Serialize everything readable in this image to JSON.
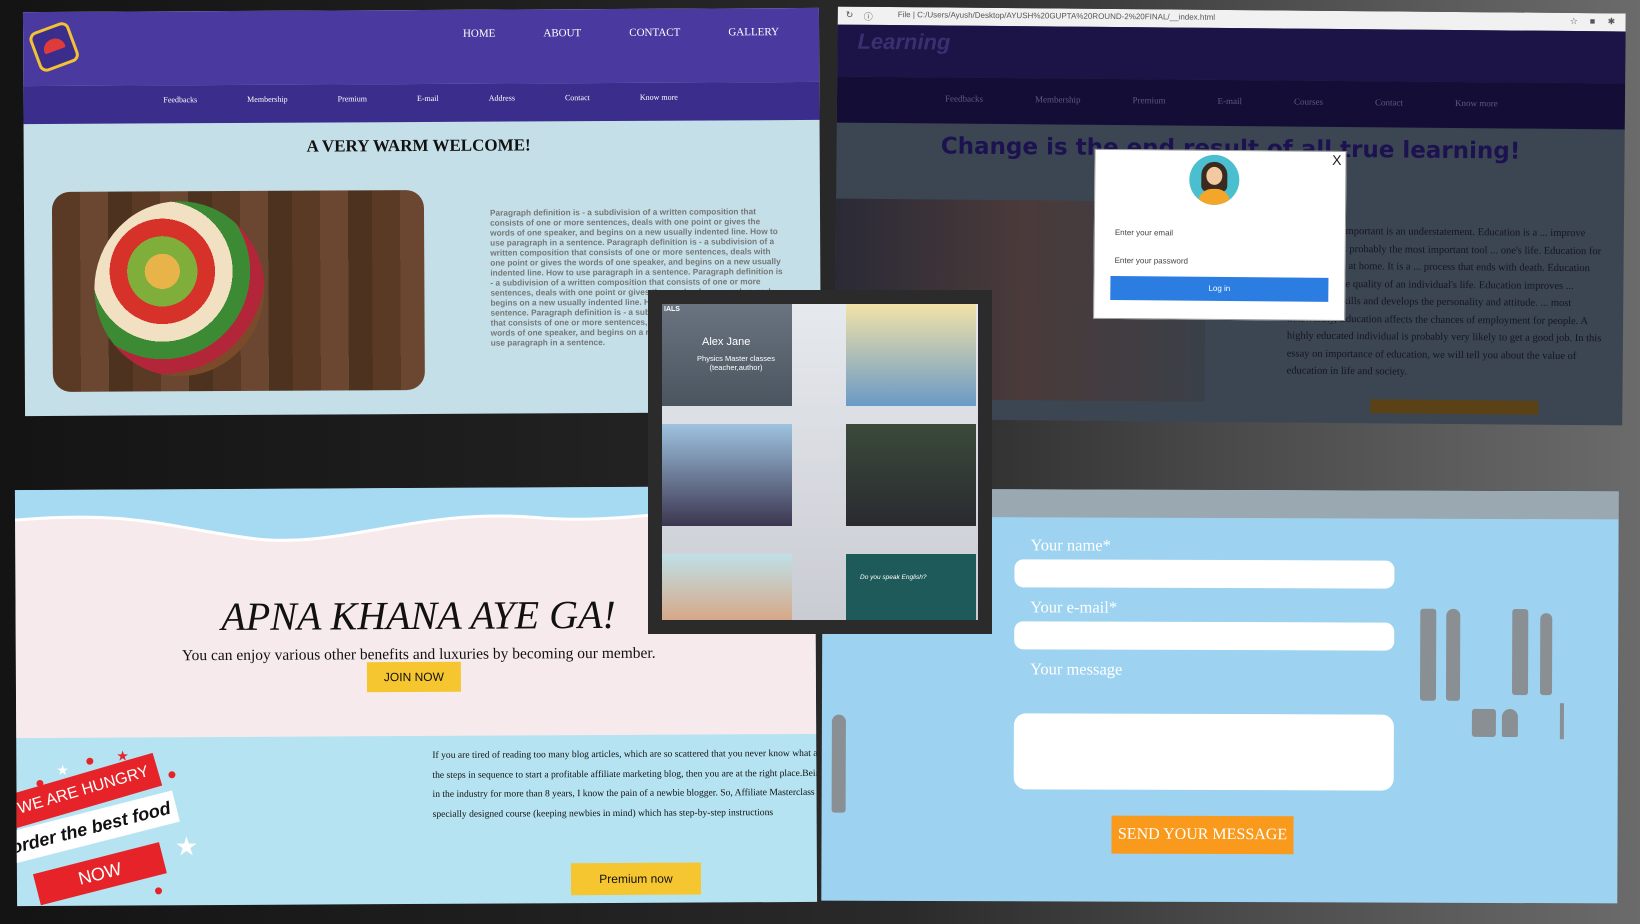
{
  "food_site": {
    "main_nav": [
      "HOME",
      "ABOUT",
      "CONTACT",
      "GALLERY"
    ],
    "sub_nav": [
      "Feedbacks",
      "Membership",
      "Premium",
      "E-mail",
      "Address",
      "Contact",
      "Know more"
    ],
    "welcome_title": "A VERY WARM WELCOME!",
    "paragraph": "Paragraph definition is - a subdivision of a written composition that consists of one or more sentences, deals with one point or gives the words of one speaker, and begins on a new usually indented line. How to use paragraph in a sentence. Paragraph definition is - a subdivision of a written composition that consists of one or more sentences, deals with one point or gives the words of one speaker, and begins on a new usually indented line. How to use paragraph in a sentence. Paragraph definition is - a subdivision of a written composition that consists of one or more sentences, deals with one point or gives the words of one speaker, and begins on a new usually indented line. How to use paragraph in a sentence. Paragraph definition is - a subdivision of a written composition that consists of one or more sentences, deals with one point or gives the words of one speaker, and begins on a new usually indented line. How to use paragraph in a sentence."
  },
  "learning_site": {
    "url": "File | C:/Users/Ayush/Desktop/AYUSH%20GUPTA%20ROUND-2%20FINAL/__index.html",
    "brand": "Learning",
    "sub_nav": [
      "Feedbacks",
      "Membership",
      "Premium",
      "E-mail",
      "Courses",
      "Contact",
      "Know more"
    ],
    "headline": "Change is the end result of all true learning!",
    "paragraph": "Education is important is an understatement. Education is a ... improve one's life. It is probably the most important tool ... one's life. Education for a child begins at home. It is a ... process that ends with death. Education certainly ... the quality of an individual's life. Education improves ... knowledge, skills and develops the personality and attitude. ... most noteworthy, Education affects the chances of employment for people. A highly educated individual is probably very likely to get a good job. In this essay on importance of education, we will tell you about the value of education in life and society.",
    "modal": {
      "close": "X",
      "email_placeholder": "Enter your email",
      "password_placeholder": "Enter your password",
      "login_label": "Log in"
    }
  },
  "tutor_grid": {
    "tile_label": "IALS",
    "tutor_name": "Alex Jane",
    "tutor_subtitle": "Physics Master classes (teacher,author)",
    "board_text": "Do you speak English?"
  },
  "apna_khana": {
    "title": "APNA KHANA AYE GA!",
    "subtitle": "You can enjoy various other benefits and luxuries by becoming our member.",
    "join_label": "JOIN NOW",
    "poster_line1": "WE ARE HUNGRY",
    "poster_line2": "order the best food",
    "poster_line3": "NOW",
    "blog_text": "If you are tired of reading too many blog articles, which are so scattered that you never know what are the steps in sequence to start a profitable affiliate marketing blog, then you are at the right place.Being in the industry for more than 8 years, I know the pain of a newbie blogger. So, Affiliate Masterclass is a specially designed course (keeping newbies in mind) which has step-by-step instructions",
    "premium_label": "Premium now"
  },
  "contact_form": {
    "name_label": "Your name*",
    "email_label": "Your e-mail*",
    "message_label": "Your message",
    "send_label": "SEND YOUR MESSAGE"
  }
}
